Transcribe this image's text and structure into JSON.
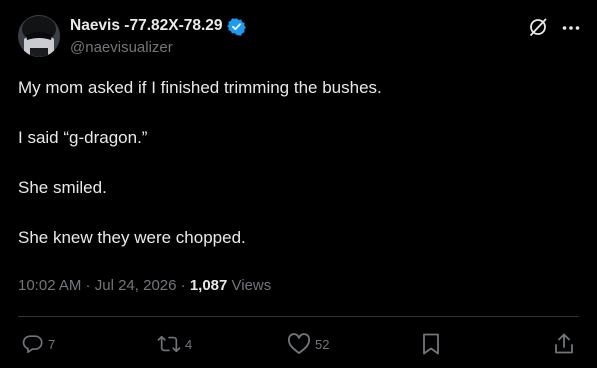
{
  "author": {
    "display_name": "Naevis -77.82X-78.29",
    "handle": "@naevisualizer",
    "verified": true
  },
  "icons": {
    "verified": "verified-badge-icon",
    "grok": "grok-icon",
    "more": "more-icon"
  },
  "colors": {
    "background": "#000000",
    "text_primary": "#e7e9ea",
    "text_secondary": "#71767b",
    "verified_blue": "#1d9bf0",
    "divider": "#2f3336"
  },
  "tweet": {
    "lines": [
      "My mom asked if I finished trimming the bushes.",
      "I said “g-dragon.”",
      "She smiled.",
      "She knew they were chopped."
    ]
  },
  "meta": {
    "time": "10:02 AM",
    "separator": " · ",
    "date": "Jul 24, 2026",
    "views_count": "1,087",
    "views_label": " Views"
  },
  "actions": {
    "replies": "7",
    "retweets": "4",
    "likes": "52",
    "bookmarks": "",
    "share": ""
  }
}
